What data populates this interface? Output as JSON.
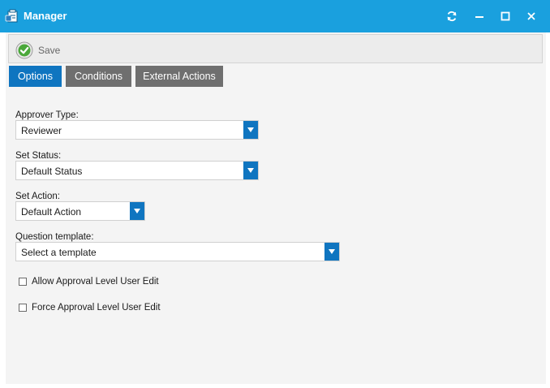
{
  "window": {
    "title": "Manager",
    "accent_color": "#1aa0de"
  },
  "toolbar": {
    "save_label": "Save"
  },
  "tabs": [
    {
      "label": "Options",
      "active": true
    },
    {
      "label": "Conditions",
      "active": false
    },
    {
      "label": "External Actions",
      "active": false
    }
  ],
  "form": {
    "approver_type": {
      "label": "Approver Type:",
      "value": "Reviewer"
    },
    "set_status": {
      "label": "Set Status:",
      "value": "Default Status"
    },
    "set_action": {
      "label": "Set Action:",
      "value": "Default Action"
    },
    "question_template": {
      "label": "Question template:",
      "value": "Select a template"
    },
    "allow_edit": {
      "label": "Allow Approval Level User Edit",
      "checked": false
    },
    "force_edit": {
      "label": "Force Approval Level User Edit",
      "checked": false
    }
  },
  "colors": {
    "tab_active": "#0f75c0",
    "tab_inactive": "#6f6f6f",
    "dropdown_arrow_bg": "#0f75c0"
  }
}
